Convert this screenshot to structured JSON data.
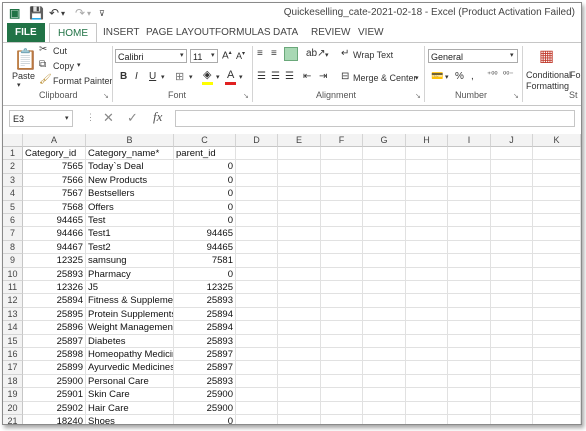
{
  "title_bar": {
    "document_title": "Quickeselling_cate-2021-02-18 - Excel (Product Activation Failed)"
  },
  "ribbon_tabs": [
    "FILE",
    "HOME",
    "INSERT",
    "PAGE LAYOUT",
    "FORMULAS",
    "DATA",
    "REVIEW",
    "VIEW"
  ],
  "clipboard": {
    "paste": "Paste",
    "cut": "Cut",
    "copy": "Copy",
    "format_painter": "Format Painter",
    "label": "Clipboard"
  },
  "font": {
    "name": "Calibri",
    "size": "11",
    "bold": "B",
    "italic": "I",
    "underline": "U",
    "label": "Font"
  },
  "alignment": {
    "wrap_text": "Wrap Text",
    "merge_center": "Merge & Center",
    "label": "Alignment"
  },
  "number": {
    "format": "General",
    "label": "Number"
  },
  "styles": {
    "conditional": "Conditional",
    "formatting": "Formatting",
    "fo_cut": "Fo",
    "st_cut": "St"
  },
  "formula_bar": {
    "name_box": "E3",
    "fx": "fx"
  },
  "columns": [
    "A",
    "B",
    "C",
    "D",
    "E",
    "F",
    "G",
    "H",
    "I",
    "J",
    "K"
  ],
  "rows": [
    {
      "n": "1",
      "a": "Category_id",
      "b": "Category_name*",
      "c": "parent_id"
    },
    {
      "n": "2",
      "a": "7565",
      "b": "Today`s Deal",
      "c": "0"
    },
    {
      "n": "3",
      "a": "7566",
      "b": "New Products",
      "c": "0"
    },
    {
      "n": "4",
      "a": "7567",
      "b": "Bestsellers",
      "c": "0"
    },
    {
      "n": "5",
      "a": "7568",
      "b": "Offers",
      "c": "0"
    },
    {
      "n": "6",
      "a": "94465",
      "b": "Test",
      "c": "0"
    },
    {
      "n": "7",
      "a": "94466",
      "b": "Test1",
      "c": "94465"
    },
    {
      "n": "8",
      "a": "94467",
      "b": "Test2",
      "c": "94465"
    },
    {
      "n": "9",
      "a": "12325",
      "b": "samsung",
      "c": "7581"
    },
    {
      "n": "10",
      "a": "25893",
      "b": "Pharmacy",
      "c": "0"
    },
    {
      "n": "11",
      "a": "12326",
      "b": "J5",
      "c": "12325"
    },
    {
      "n": "12",
      "a": "25894",
      "b": "Fitness & Supplemer",
      "c": "25893"
    },
    {
      "n": "13",
      "a": "25895",
      "b": "Protein Supplements",
      "c": "25894"
    },
    {
      "n": "14",
      "a": "25896",
      "b": "Weight Management",
      "c": "25894"
    },
    {
      "n": "15",
      "a": "25897",
      "b": "Diabetes",
      "c": "25893"
    },
    {
      "n": "16",
      "a": "25898",
      "b": "Homeopathy Medicir",
      "c": "25897"
    },
    {
      "n": "17",
      "a": "25899",
      "b": "Ayurvedic Medicines",
      "c": "25897"
    },
    {
      "n": "18",
      "a": "25900",
      "b": "Personal Care",
      "c": "25893"
    },
    {
      "n": "19",
      "a": "25901",
      "b": "Skin Care",
      "c": "25900"
    },
    {
      "n": "20",
      "a": "25902",
      "b": "Hair Care",
      "c": "25900"
    },
    {
      "n": "21",
      "a": "18240",
      "b": "Shoes",
      "c": "0"
    }
  ]
}
